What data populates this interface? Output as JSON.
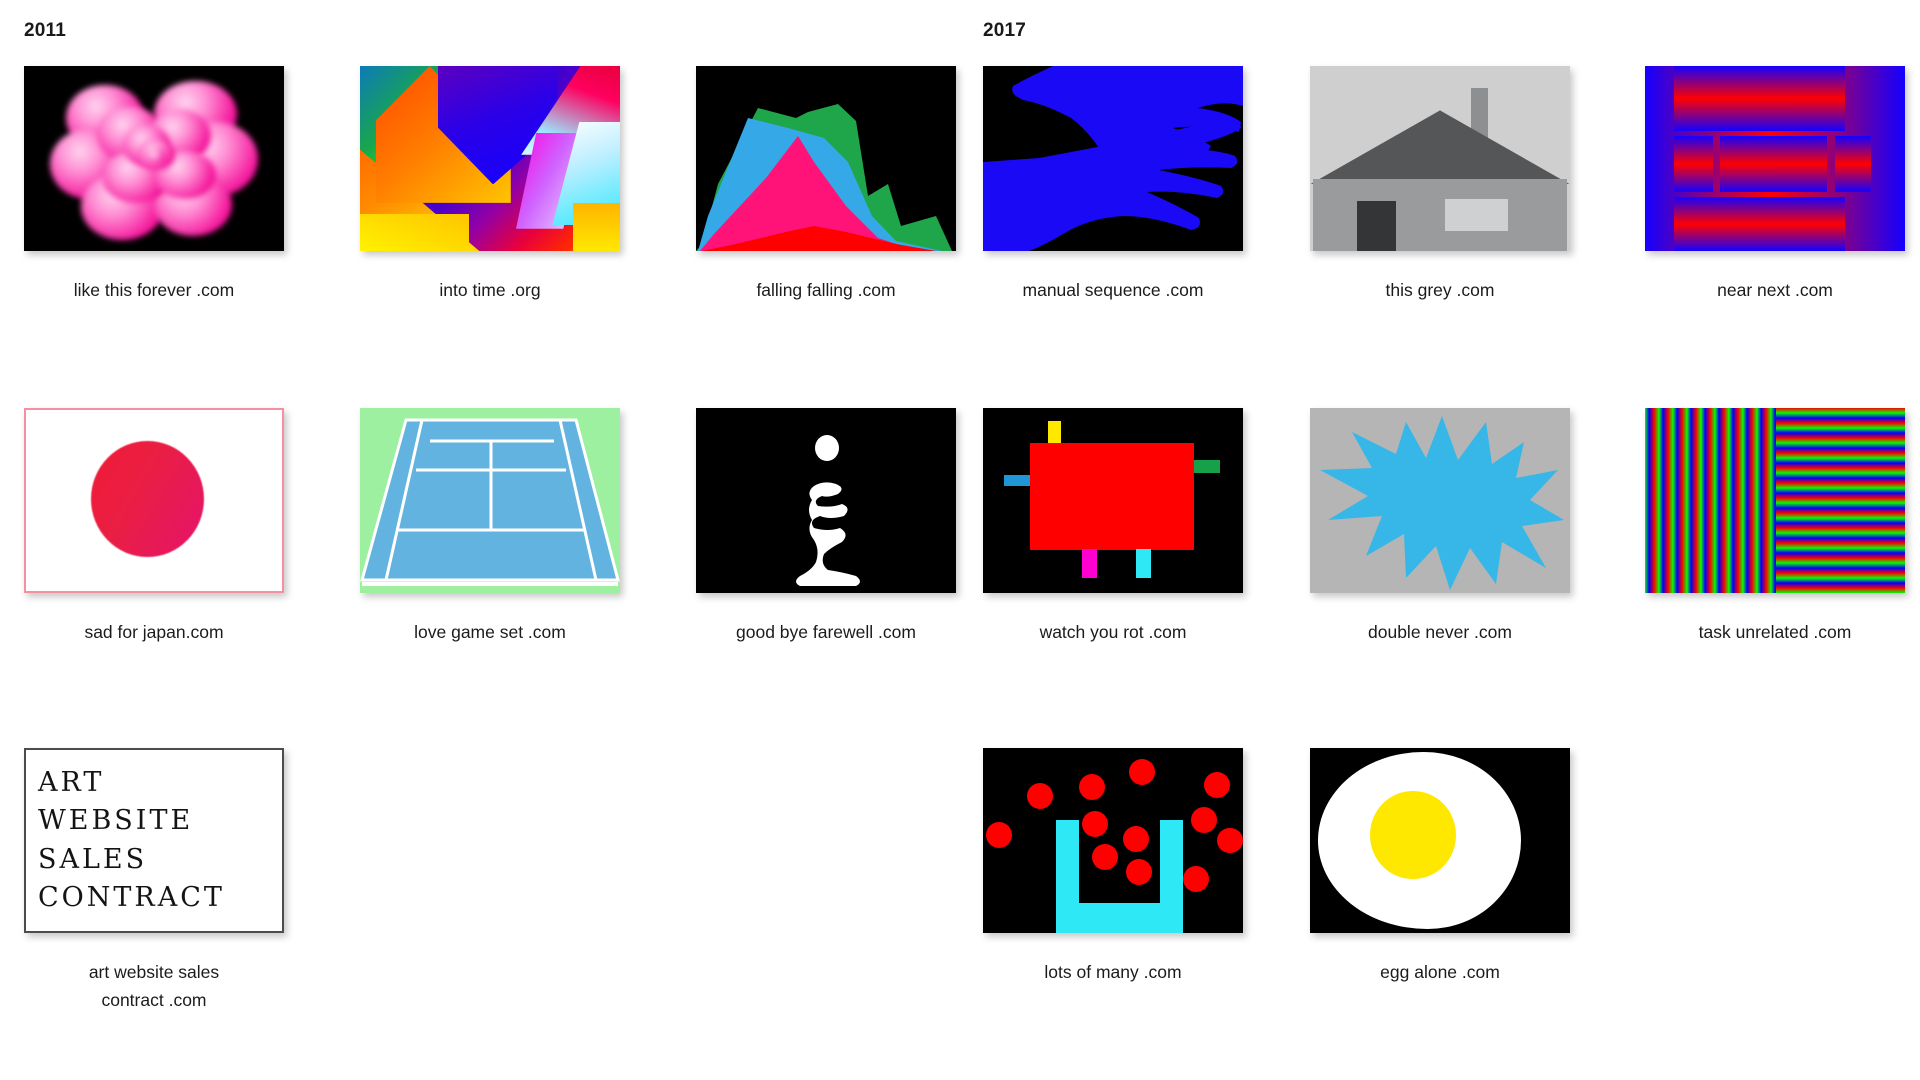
{
  "page": {
    "background": "#ffffff",
    "text_color": "#1b1b1b"
  },
  "year_markers": [
    {
      "label": "2011",
      "column": 1
    },
    {
      "label": "2017",
      "column": 4
    }
  ],
  "grid": {
    "columns": 6,
    "rows": 3,
    "thumb_width": 260,
    "thumb_height": 185
  },
  "items": [
    {
      "id": "like-this-forever",
      "caption": "like this forever .com",
      "row": 1,
      "col": 1,
      "artwork": "pink-rose-on-black",
      "colors": {
        "background": "#000000",
        "primary": "#f5179c",
        "highlight": "#ffd4ef"
      }
    },
    {
      "id": "into-time",
      "caption": "into time .org",
      "row": 1,
      "col": 2,
      "artwork": "diagonal-rainbow-gradient-bands",
      "colors": {
        "green": "#16a34a",
        "blue": "#2a00d8",
        "orange": "#ff7a00",
        "yellow": "#ffe000",
        "magenta": "#ff00e0",
        "cyan": "#35e8ff"
      }
    },
    {
      "id": "falling-falling",
      "caption": "falling falling .com",
      "row": 1,
      "col": 3,
      "artwork": "stacked-area-mountain-chart",
      "colors": {
        "background": "#000000",
        "green": "#1fa64a",
        "blue": "#35a8e8",
        "pink": "#ff1379",
        "red": "#fe0000"
      }
    },
    {
      "id": "manual-sequence",
      "caption": "manual sequence .com",
      "row": 1,
      "col": 4,
      "artwork": "two-blue-hand-silhouettes",
      "colors": {
        "background": "#000000",
        "hands": "#1a09f5"
      }
    },
    {
      "id": "this-grey",
      "caption": "this grey .com",
      "row": 1,
      "col": 5,
      "artwork": "grey-house-with-chimney",
      "colors": {
        "sky": "#cfcfcf",
        "roof": "#555657",
        "wall": "#9a9b9c",
        "door": "#343536",
        "window": "#cfd0d1"
      }
    },
    {
      "id": "near-next",
      "caption": "near next .com",
      "row": 1,
      "col": 6,
      "artwork": "red-blue-gradient-nested-frames",
      "colors": {
        "red": "#ff0000",
        "blue": "#1500ff"
      }
    },
    {
      "id": "sad-for-japan",
      "caption": "sad for japan.com",
      "row": 2,
      "col": 1,
      "artwork": "japan-flag-gradient-sun",
      "colors": {
        "field": "#ffffff",
        "border": "#f4909f",
        "sun": "#e5136b"
      }
    },
    {
      "id": "love-game-set",
      "caption": "love game set .com",
      "row": 2,
      "col": 2,
      "artwork": "tennis-court-perspective",
      "colors": {
        "surround": "#9cf0a0",
        "court": "#63b3e0",
        "lines": "#ffffff"
      }
    },
    {
      "id": "good-bye-farewell",
      "caption": "good bye farewell .com",
      "row": 2,
      "col": 3,
      "artwork": "white-abstract-figure-on-black",
      "colors": {
        "background": "#000000",
        "figure": "#ffffff"
      }
    },
    {
      "id": "watch-you-rot",
      "caption": "watch you rot .com",
      "row": 2,
      "col": 4,
      "artwork": "red-block-with-colour-tabs",
      "colors": {
        "background": "#000000",
        "block": "#fe0000",
        "yellow": "#ffe800",
        "green": "#17a04a",
        "blue": "#2196d6",
        "magenta": "#ff00d0",
        "cyan": "#2ee8f5"
      }
    },
    {
      "id": "double-never",
      "caption": "double never .com",
      "row": 2,
      "col": 5,
      "artwork": "cyan-starburst-on-grey",
      "colors": {
        "background": "#b5b5b5",
        "star": "#37b6e8"
      }
    },
    {
      "id": "task-unrelated",
      "caption": "task unrelated .com",
      "row": 2,
      "col": 6,
      "artwork": "rgb-stripes-vertical-and-horizontal",
      "colors": {
        "red": "#ff0000",
        "green": "#00ff00",
        "blue": "#0000ff"
      }
    },
    {
      "id": "art-website-sales-contract",
      "caption": "art website sales\ncontract .com",
      "caption_line1": "art website sales",
      "caption_line2": "contract .com",
      "row": 3,
      "col": 1,
      "artwork": "typewriter-text-document",
      "document_lines": [
        "ART",
        "WEBSITE",
        "SALES",
        "CONTRACT"
      ],
      "colors": {
        "background": "#ffffff",
        "border": "#4c4c4c",
        "text": "#141414"
      }
    },
    {
      "id": "lots-of-many",
      "caption": "lots of many .com",
      "row": 3,
      "col": 4,
      "artwork": "red-dots-with-cyan-u-shape",
      "colors": {
        "background": "#000000",
        "dots": "#fe0000",
        "u_shape": "#2ee8f5"
      }
    },
    {
      "id": "egg-alone",
      "caption": "egg alone .com",
      "row": 3,
      "col": 5,
      "artwork": "fried-egg-on-black",
      "colors": {
        "background": "#000000",
        "white": "#ffffff",
        "yolk": "#ffe800"
      }
    }
  ]
}
